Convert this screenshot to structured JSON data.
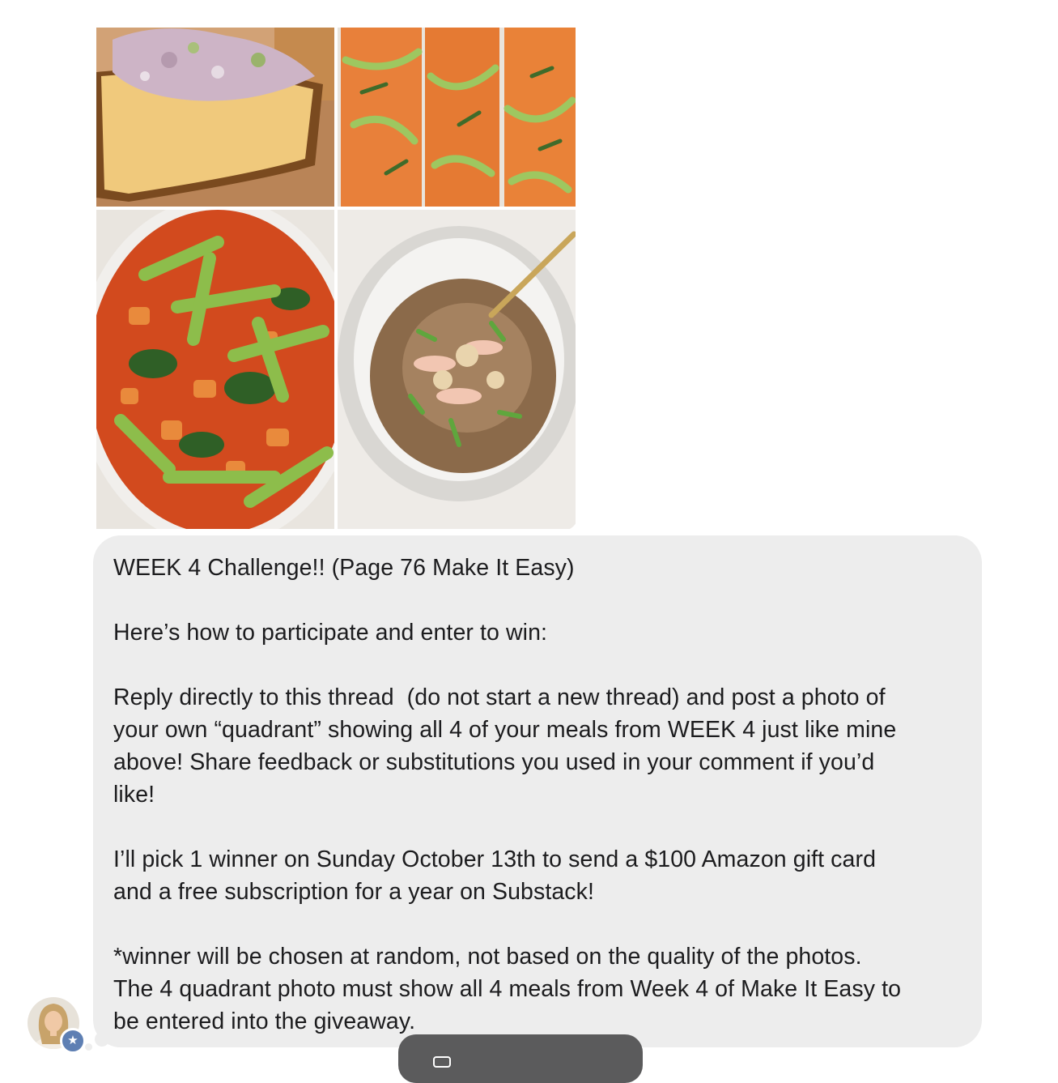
{
  "post": {
    "photo_grid": {
      "tiles": [
        {
          "icon": "chicken-salad-toast-photo"
        },
        {
          "icon": "crusted-salmon-photo"
        },
        {
          "icon": "snap-pea-chicken-curry-photo"
        },
        {
          "icon": "egg-roll-bowl-photo"
        }
      ]
    },
    "message": {
      "lines": [
        "WEEK 4 Challenge!! (Page 76 Make It Easy)",
        "Here’s how to participate and enter to win:",
        "Reply directly to this thread  (do not start a new thread) and post a photo of",
        "your own “quadrant” showing all 4 of your meals from WEEK 4 just like mine",
        "above! Share feedback or substitutions you used in your comment if you’d",
        "like!",
        "I’ll pick 1 winner on Sunday October 13th to send a $100 Amazon gift card",
        "and a free subscription for a year on Substack!",
        "*winner will be chosen at random, not based on the quality of the photos.",
        "The 4 quadrant photo must show all 4 meals from Week 4 of Make It Easy to",
        "be entered into the giveaway."
      ]
    },
    "author": {
      "avatar_icon": "author-avatar-icon",
      "badge_glyph": "★",
      "badge_icon": "star-badge-icon"
    }
  },
  "colors": {
    "bubble_bg": "#ededed",
    "text": "#1c1c1e",
    "badge": "#5e7fb3",
    "bottom_pill": "#5b5b5c"
  }
}
